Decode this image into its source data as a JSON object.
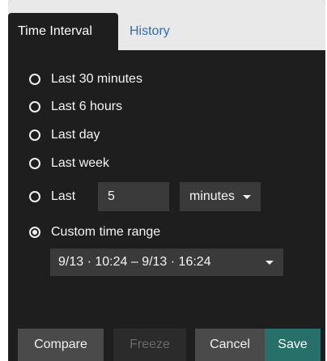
{
  "tabs": [
    {
      "label": "Time Interval",
      "active": true
    },
    {
      "label": "History",
      "active": false
    }
  ],
  "options": [
    {
      "label": "Last 30 minutes",
      "checked": false
    },
    {
      "label": "Last 6 hours",
      "checked": false
    },
    {
      "label": "Last day",
      "checked": false
    },
    {
      "label": "Last week",
      "checked": false
    },
    {
      "label": "Last",
      "checked": false
    },
    {
      "label": "Custom time range",
      "checked": true
    }
  ],
  "last_n": {
    "value": "5",
    "unit": "minutes"
  },
  "custom_range": {
    "value": "9/13 · 10:24 – 9/13 · 16:24"
  },
  "buttons": {
    "compare": "Compare",
    "freeze": "Freeze",
    "cancel": "Cancel",
    "save": "Save"
  },
  "colors": {
    "panel_bg": "#1e1e1e",
    "tab_bar_bg": "#e9e9e9",
    "link_blue": "#2f6eb5",
    "field_bg": "#3a3a3a",
    "save_teal": "#27706a"
  }
}
